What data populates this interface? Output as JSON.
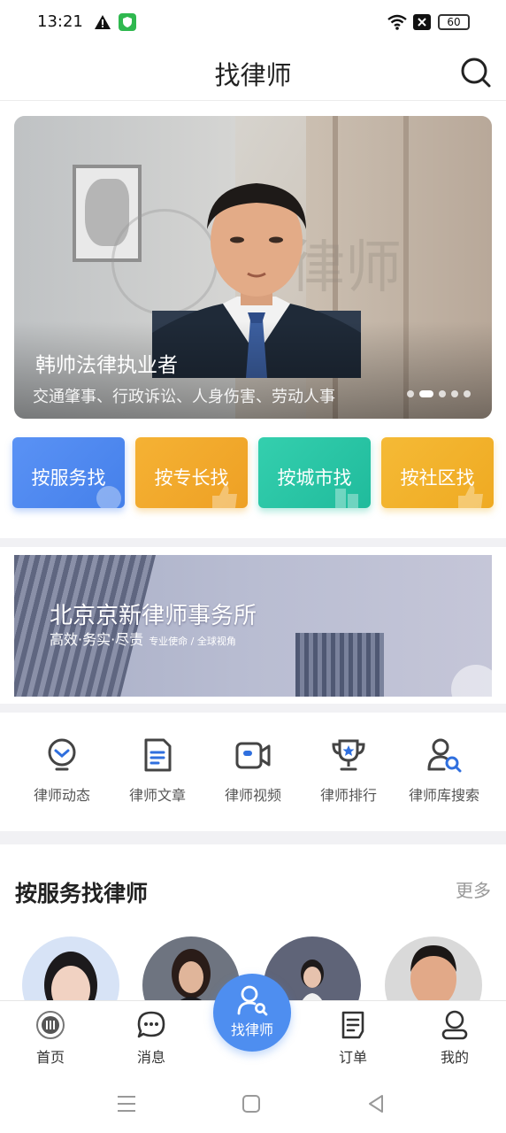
{
  "status_bar": {
    "time": "13:21",
    "battery": "60"
  },
  "header": {
    "title": "找律师"
  },
  "banner": {
    "name": "韩帅法律执业者",
    "description": "交通肇事、行政诉讼、人身伤害、劳动人事",
    "watermark": "律师",
    "slides": 5,
    "active_slide": 2
  },
  "quick_find": [
    {
      "label": "按服务找",
      "color": "#4d86f0"
    },
    {
      "label": "按专长找",
      "color": "#f0a928"
    },
    {
      "label": "按城市找",
      "color": "#27c4a4"
    },
    {
      "label": "按社区找",
      "color": "#f0b42c"
    }
  ],
  "firm_banner": {
    "title": "北京京新律师事务所",
    "slogan": "高效·务实·尽责",
    "slogan_small": "专业使命 / 全球视角"
  },
  "categories": [
    {
      "label": "律师动态",
      "icon": "bulb-icon"
    },
    {
      "label": "律师文章",
      "icon": "document-icon"
    },
    {
      "label": "律师视频",
      "icon": "video-icon"
    },
    {
      "label": "律师排行",
      "icon": "trophy-icon"
    },
    {
      "label": "律师库搜索",
      "icon": "person-search-icon"
    }
  ],
  "section": {
    "title": "按服务找律师",
    "more": "更多"
  },
  "bottom_nav": [
    {
      "label": "首页",
      "icon": "home-emblem-icon"
    },
    {
      "label": "消息",
      "icon": "chat-icon"
    },
    {
      "label": "找律师",
      "icon": "find-lawyer-icon"
    },
    {
      "label": "订单",
      "icon": "order-icon"
    },
    {
      "label": "我的",
      "icon": "profile-icon"
    }
  ],
  "colors": {
    "accent": "#4e8ef0",
    "icon_blue": "#2f6fde",
    "icon_dark": "#444444"
  }
}
